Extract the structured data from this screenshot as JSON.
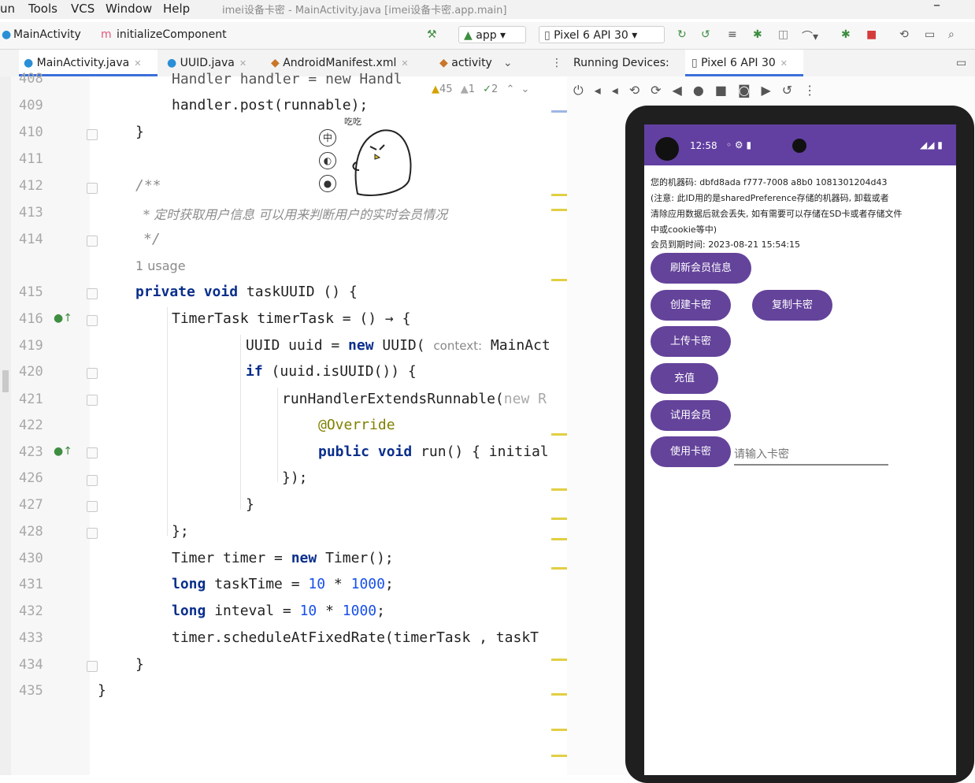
{
  "menu": [
    "un",
    "Tools",
    "VCS",
    "Window",
    "Help"
  ],
  "window_title": "imei设备卡密 - MainActivity.java [imei设备卡密.app.main]",
  "navbar": {
    "breadcrumb": [
      "MainActivity",
      "initializeComponent"
    ],
    "run_config": "app",
    "device": "Pixel 6 API 30"
  },
  "tabs": [
    {
      "label": "MainActivity.java",
      "active": true
    },
    {
      "label": "UUID.java",
      "active": false
    },
    {
      "label": "AndroidManifest.xml",
      "active": false
    },
    {
      "label": "activity",
      "active": false
    }
  ],
  "running_devices": {
    "label": "Running Devices:",
    "tab": "Pixel 6 API 30"
  },
  "inspection": {
    "warnings": "45",
    "weak": "1",
    "typos": "2"
  },
  "code": {
    "lines": [
      {
        "n": "408",
        "text": "Handler handler = new Handl"
      },
      {
        "n": "409",
        "text": "handler.post(runnable);"
      },
      {
        "n": "410",
        "text": "}"
      },
      {
        "n": "411",
        "text": ""
      },
      {
        "n": "412",
        "text": "/**"
      },
      {
        "n": "413",
        "text": "* 定时获取用户信息 可以用来判断用户的实时会员情况"
      },
      {
        "n": "414",
        "text": "*/"
      },
      {
        "n": "",
        "text": "1 usage"
      },
      {
        "n": "415",
        "text": "private void taskUUID () {"
      },
      {
        "n": "416",
        "text": "TimerTask timerTask = () → {"
      },
      {
        "n": "419",
        "text": "UUID uuid = new UUID( context: MainAct"
      },
      {
        "n": "420",
        "text": "if (uuid.isUUID()) {"
      },
      {
        "n": "421",
        "text": "runHandlerExtendsRunnable(new R"
      },
      {
        "n": "422",
        "text": "@Override"
      },
      {
        "n": "423",
        "text": "public void run() { initial"
      },
      {
        "n": "426",
        "text": "});"
      },
      {
        "n": "427",
        "text": "}"
      },
      {
        "n": "428",
        "text": "};"
      },
      {
        "n": "430",
        "text": "Timer timer = new Timer();"
      },
      {
        "n": "431",
        "text": "long taskTime = 10 * 1000;"
      },
      {
        "n": "432",
        "text": "long inteval = 10 * 1000;"
      },
      {
        "n": "433",
        "text": "timer.scheduleAtFixedRate(timerTask , taskT"
      },
      {
        "n": "434",
        "text": "}"
      },
      {
        "n": "435",
        "text": "}"
      }
    ],
    "overlay_mark": "吃吃"
  },
  "phone": {
    "time": "12:58",
    "info_lines": [
      "您的机器码: dbfd8ada f777-7008 a8b0 1081301204d43",
      "(注意: 此ID用的是sharedPreference存储的机器码, 卸载或者",
      "清除应用数据后就会丢失, 如有需要可以存储在SD卡或者存储文件",
      "中或cookie等中)",
      "会员到期时间: 2023-08-21 15:54:15"
    ],
    "buttons": {
      "refresh": "刷新会员信息",
      "create": "创建卡密",
      "copy": "复制卡密",
      "upload": "上传卡密",
      "recharge": "充值",
      "trial": "试用会员",
      "use_card": "使用卡密"
    },
    "card_placeholder": "请输入卡密"
  },
  "colors": {
    "accent": "#64439b",
    "statusbar": "#6140a1",
    "keyword": "#0a2f8c",
    "tab_active": "#3b6fd9"
  }
}
